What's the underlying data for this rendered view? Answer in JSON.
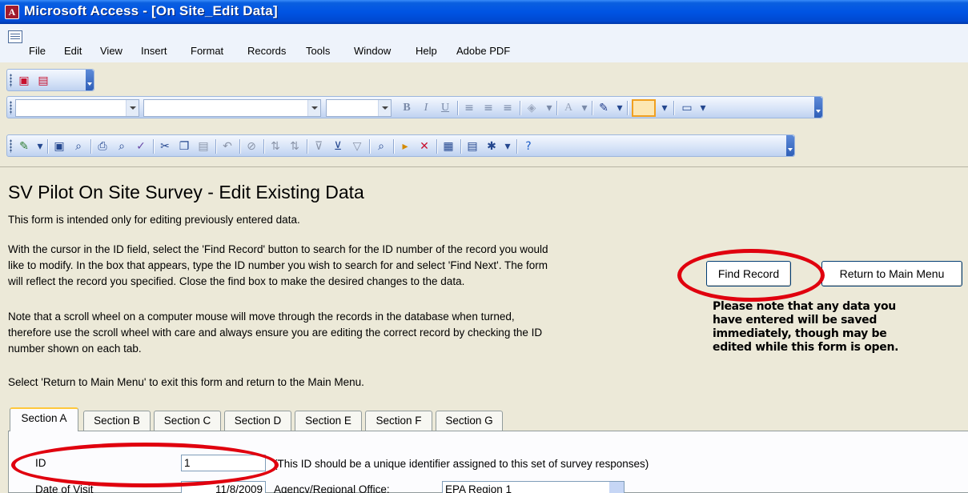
{
  "window": {
    "title": "Microsoft Access - [On Site_Edit Data]",
    "icon": "access-icon"
  },
  "menu": {
    "items": [
      {
        "label": "File",
        "accel": "F"
      },
      {
        "label": "Edit",
        "accel": "E"
      },
      {
        "label": "View",
        "accel": "V"
      },
      {
        "label": "Insert",
        "accel": "I"
      },
      {
        "label": "Format",
        "accel": "o"
      },
      {
        "label": "Records",
        "accel": "R"
      },
      {
        "label": "Tools",
        "accel": "T"
      },
      {
        "label": "Window",
        "accel": "W"
      },
      {
        "label": "Help",
        "accel": "H"
      },
      {
        "label": "Adobe PDF",
        "accel": "b"
      }
    ]
  },
  "form": {
    "heading": "SV Pilot On Site Survey - Edit Existing Data",
    "intro": "This form is intended only for editing previously entered data.",
    "instructions": [
      "With the cursor in the ID field, select the 'Find Record' button to search for the ID number of the record you would",
      "like to modify. In the box that appears, type the ID number you wish to search for and select 'Find Next'. The form",
      "will reflect the record you specified. Close the find box to make the desired changes to the data."
    ],
    "scroll_note": [
      "Note that a scroll wheel on a computer mouse will move through the records in the database when turned,",
      "therefore use the scroll wheel with care and always ensure you are editing the correct record by checking the ID",
      "number shown on each tab."
    ],
    "return_note": "Select 'Return to Main Menu' to exit this form and return to the Main Menu.",
    "find_record_label": "Find Record",
    "return_main_label": "Return to Main Menu",
    "warning": [
      "Please note that any data you",
      "have entered will be saved",
      "immediately, though may be",
      "edited while this form is open."
    ]
  },
  "tabs": [
    {
      "label": "Section A",
      "active": true
    },
    {
      "label": "Section B"
    },
    {
      "label": "Section C"
    },
    {
      "label": "Section D"
    },
    {
      "label": "Section E"
    },
    {
      "label": "Section F"
    },
    {
      "label": "Section G"
    }
  ],
  "section_a": {
    "id_label": "ID",
    "id_value": "1",
    "id_hint": "(This ID should be a unique identifier assigned to this set of survey responses)",
    "visit_label": "Date of Visit",
    "visit_value": "11/8/2009",
    "agency_label": "Agency/Regional Office:",
    "agency_value": "EPA Region 1"
  },
  "colors": {
    "highlight_circle": "#E0000E",
    "title_bar": "#0054E3",
    "form_bg": "#ECE9D8"
  }
}
